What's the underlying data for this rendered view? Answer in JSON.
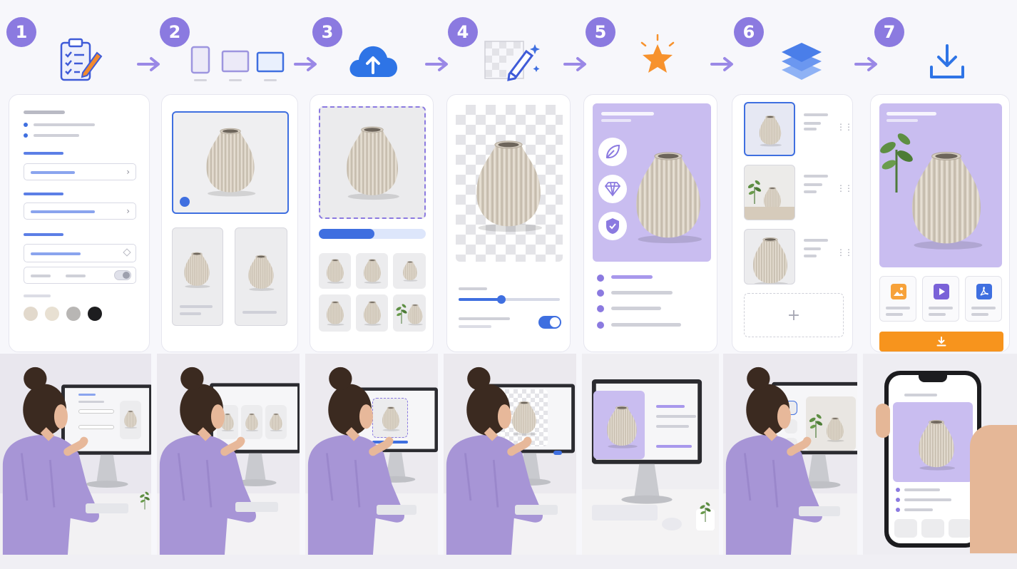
{
  "steps": [
    {
      "number": "1",
      "icon": "clipboard-checklist-icon"
    },
    {
      "number": "2",
      "icon": "device-frames-icon"
    },
    {
      "number": "3",
      "icon": "cloud-upload-icon"
    },
    {
      "number": "4",
      "icon": "magic-eraser-icon"
    },
    {
      "number": "5",
      "icon": "sparkle-star-icon"
    },
    {
      "number": "6",
      "icon": "layers-icon"
    },
    {
      "number": "7",
      "icon": "download-icon"
    }
  ],
  "colors": {
    "accent_purple": "#8b7ae0",
    "accent_blue": "#2f6fe4",
    "lavender_bg": "#c9bdf0",
    "download_orange": "#f7941d"
  },
  "panel1": {
    "swatches": [
      "#e2d9cc",
      "#e8e0d2",
      "#b8b6b4",
      "#1d1d1f"
    ]
  },
  "panel3": {
    "upload_progress": 0.52
  },
  "panel4": {
    "slider_value": 0.42,
    "toggle_on": true
  },
  "panel7": {
    "output_icons": [
      "image-file-icon",
      "video-file-icon",
      "pdf-file-icon"
    ]
  },
  "panel6": {
    "add_label": "+"
  }
}
